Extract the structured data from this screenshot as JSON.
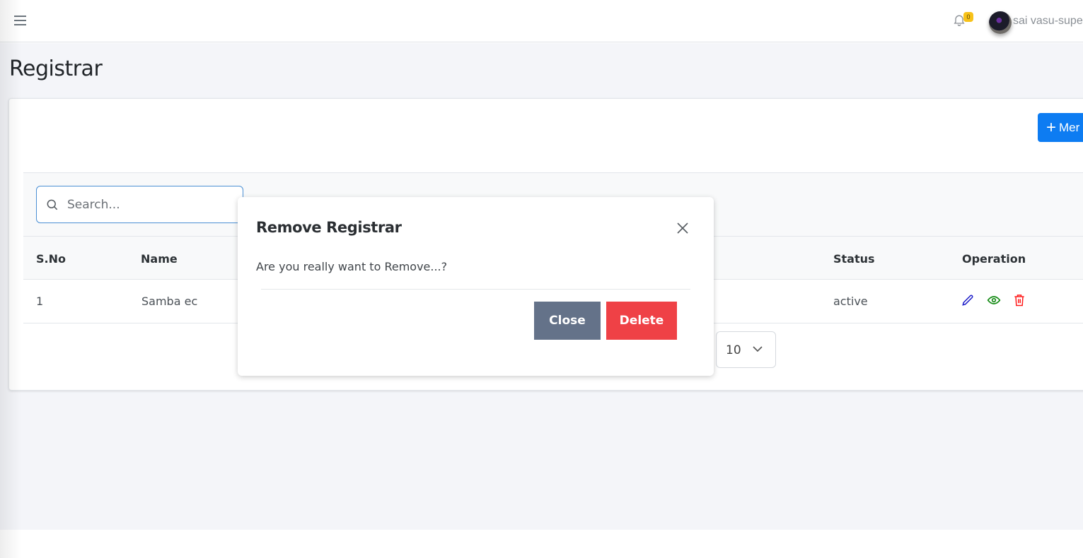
{
  "topbar": {
    "menu_icon": "hamburger-icon",
    "notification_icon": "bell-icon",
    "notification_count": "0",
    "user_name": "sai vasu-supe"
  },
  "page": {
    "title": "Registrar",
    "add_button_label": "Mer",
    "add_button_icon": "plus-icon"
  },
  "search": {
    "placeholder": "Search...",
    "value": ""
  },
  "table": {
    "columns": [
      "S.No",
      "Name",
      "Status",
      "Operation"
    ],
    "rows": [
      {
        "sno": "1",
        "name": "Samba ec",
        "status": "active",
        "operations": [
          "edit-icon",
          "view-icon",
          "delete-icon"
        ]
      }
    ]
  },
  "pagination": {
    "page_size": "10"
  },
  "modal": {
    "title": "Remove Registrar",
    "message": "Are you really want to Remove...?",
    "close_label": "Close",
    "delete_label": "Delete"
  },
  "colors": {
    "primary": "#0d7cf2",
    "close_button": "#647289",
    "delete_button": "#ef4146",
    "edit_icon": "#1a1ac8",
    "view_icon": "#138a13",
    "delete_icon": "#ff1a1a",
    "badge": "#f7c21a"
  }
}
